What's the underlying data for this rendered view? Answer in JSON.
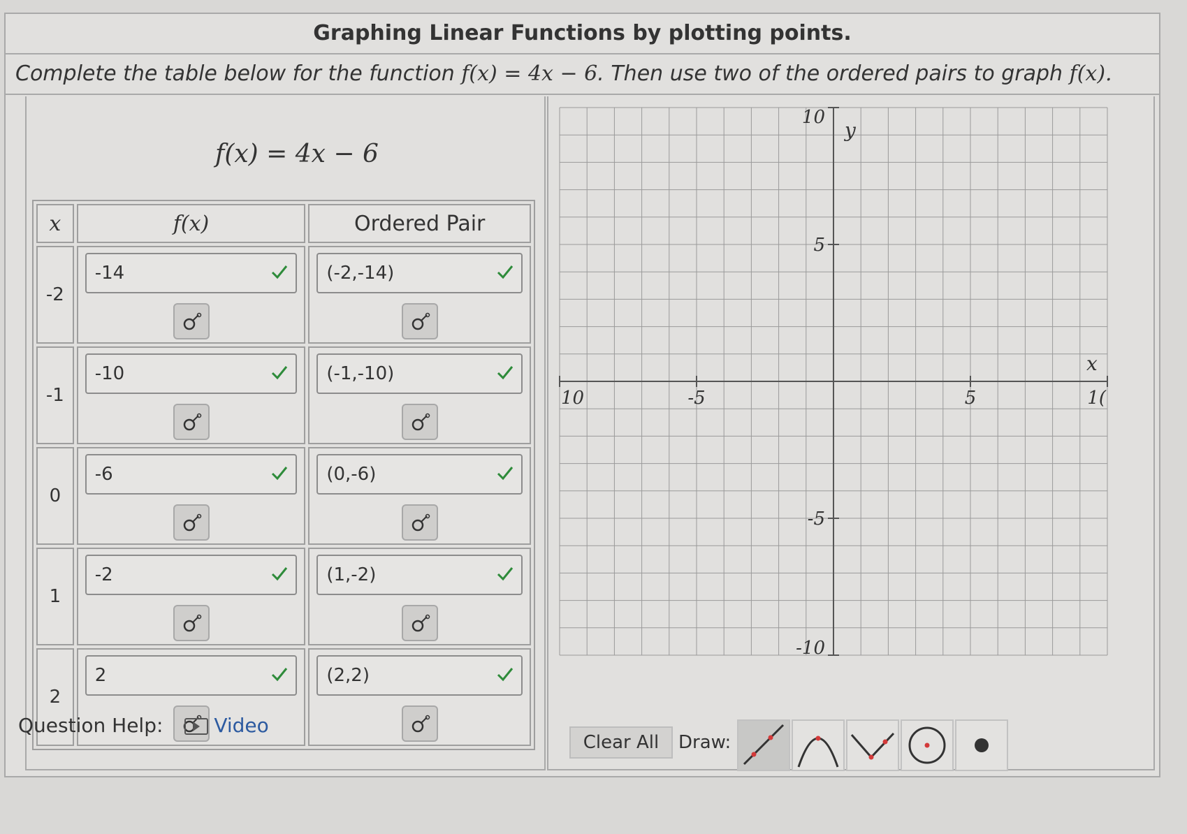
{
  "header": {
    "title": "Graphing Linear Functions by plotting points.",
    "instruction_pre": "Complete the table below for the function",
    "function_expr": "f(x) = 4x − 6",
    "instruction_post": ". Then use two of the ordered pairs to graph",
    "instruction_end": "f(x)."
  },
  "table": {
    "function_label": "f(x) = 4x − 6",
    "headers": {
      "x": "x",
      "fx": "f(x)",
      "pair": "Ordered Pair"
    },
    "rows": [
      {
        "x": "-2",
        "fx": "-14",
        "pair": "(-2,-14)"
      },
      {
        "x": "-1",
        "fx": "-10",
        "pair": "(-1,-10)"
      },
      {
        "x": "0",
        "fx": "-6",
        "pair": "(0,-6)"
      },
      {
        "x": "1",
        "fx": "-2",
        "pair": "(1,-2)"
      },
      {
        "x": "2",
        "fx": "2",
        "pair": "(2,2)"
      }
    ]
  },
  "graph": {
    "x_label": "x",
    "y_label": "y",
    "x_min": -10,
    "x_max": 10,
    "y_min": -10,
    "y_max": 10,
    "x_tick_labels": [
      "10",
      "-5",
      "5",
      "1("
    ],
    "y_tick_labels": [
      "10",
      "5",
      "-5",
      "-10"
    ]
  },
  "tools": {
    "clear_label": "Clear All",
    "draw_label": "Draw:",
    "items": [
      "line-tool-icon",
      "parabola-tool-icon",
      "absolute-value-tool-icon",
      "circle-tool-icon",
      "point-tool-icon"
    ]
  },
  "help": {
    "label": "Question Help:",
    "video": "Video"
  },
  "colors": {
    "check": "#2e8b3a",
    "link": "#2c5aa0",
    "tool_accent": "#d33a3a"
  }
}
